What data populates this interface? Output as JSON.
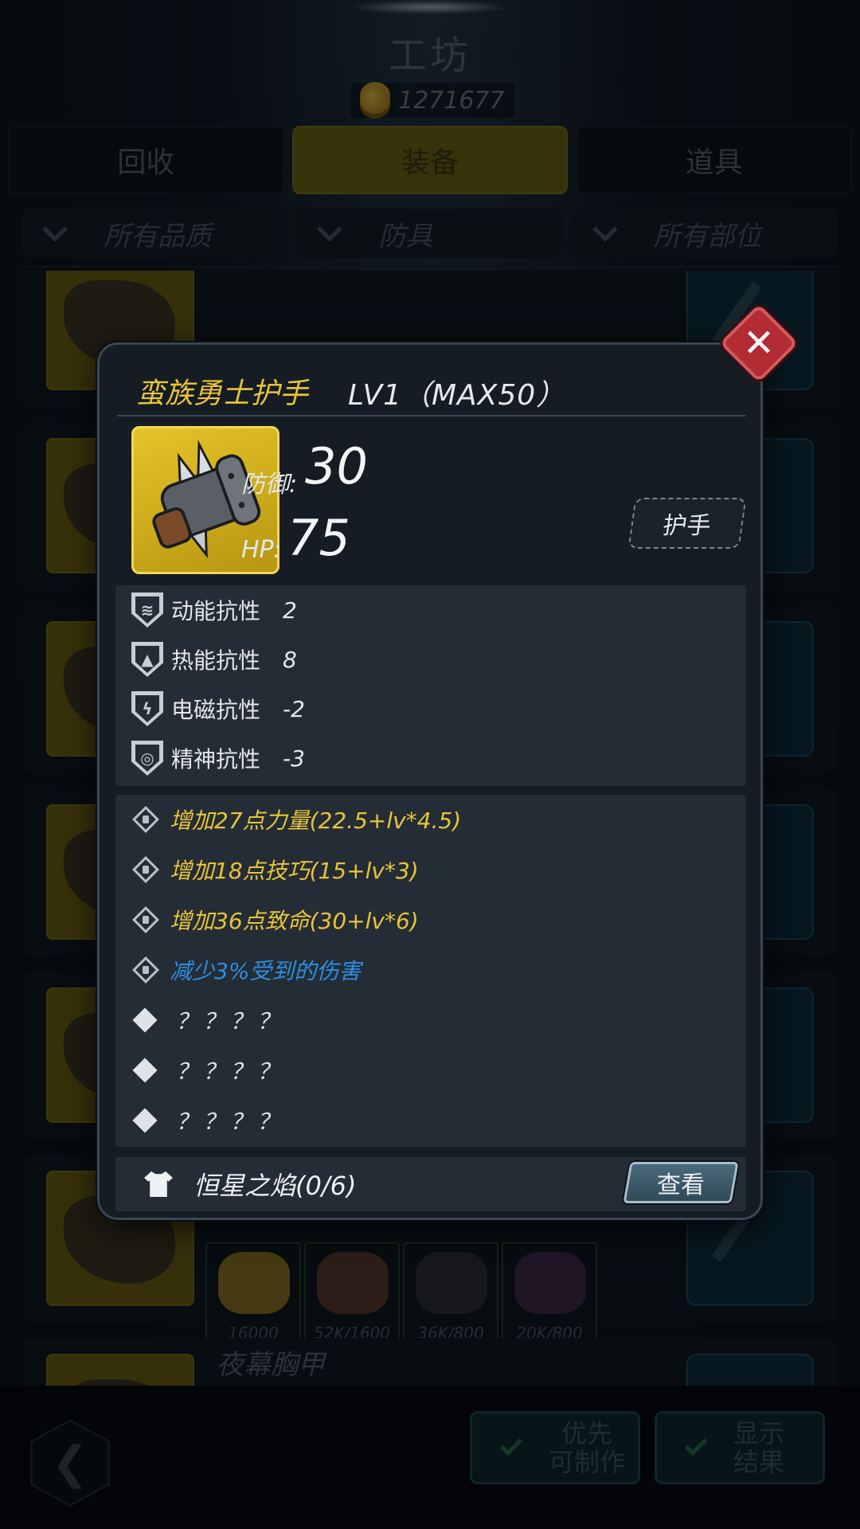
{
  "screen": {
    "title": "工坊",
    "coins": "1271677"
  },
  "tabs": [
    {
      "label": "回收",
      "active": false
    },
    {
      "label": "装备",
      "active": true
    },
    {
      "label": "道具",
      "active": false
    }
  ],
  "filters": [
    {
      "label": "所有品质"
    },
    {
      "label": "防具"
    },
    {
      "label": "所有部位"
    }
  ],
  "list": {
    "visible_row_name": "夜幕胸甲",
    "materials": [
      {
        "qty": "16000",
        "color": "#8a7424"
      },
      {
        "qty": "52K/1600",
        "color": "#5a3a2e"
      },
      {
        "qty": "36K/800",
        "color": "#2c3038"
      },
      {
        "qty": "20K/800",
        "color": "#3f2b4a"
      }
    ]
  },
  "bottom": {
    "priority_btn": [
      "优先",
      "可制作"
    ],
    "show_btn": [
      "显示",
      "结果"
    ]
  },
  "item": {
    "name": "蛮族勇士护手",
    "level": "LV1（MAX50）",
    "defense_label": "防御:",
    "defense": "30",
    "hp_label": "HP:",
    "hp": "75",
    "slot": "护手",
    "resistances": [
      {
        "icon": "kinetic-icon",
        "name": "动能抗性",
        "value": "2"
      },
      {
        "icon": "thermal-icon",
        "name": "热能抗性",
        "value": "8"
      },
      {
        "icon": "electromagnetic-icon",
        "name": "电磁抗性",
        "value": "-2"
      },
      {
        "icon": "mental-icon",
        "name": "精神抗性",
        "value": "-3"
      }
    ],
    "attributes": [
      {
        "text": "增加27点力量(22.5+lv*4.5)",
        "color": "yellow",
        "locked": true
      },
      {
        "text": "增加18点技巧(15+lv*3)",
        "color": "yellow",
        "locked": true
      },
      {
        "text": "增加36点致命(30+lv*6)",
        "color": "yellow",
        "locked": true
      },
      {
        "text": "减少3%受到的伤害",
        "color": "blue",
        "locked": true
      },
      {
        "text": "？？？？",
        "color": "white",
        "locked": false
      },
      {
        "text": "？？？？",
        "color": "white",
        "locked": false
      },
      {
        "text": "？？？？",
        "color": "white",
        "locked": false
      }
    ],
    "set_name": "恒星之焰(0/6)",
    "view_label": "查看"
  },
  "colors": {
    "accent_yellow": "#e8c43a",
    "accent_blue": "#2f8ee0",
    "close_red": "#b32b33"
  }
}
